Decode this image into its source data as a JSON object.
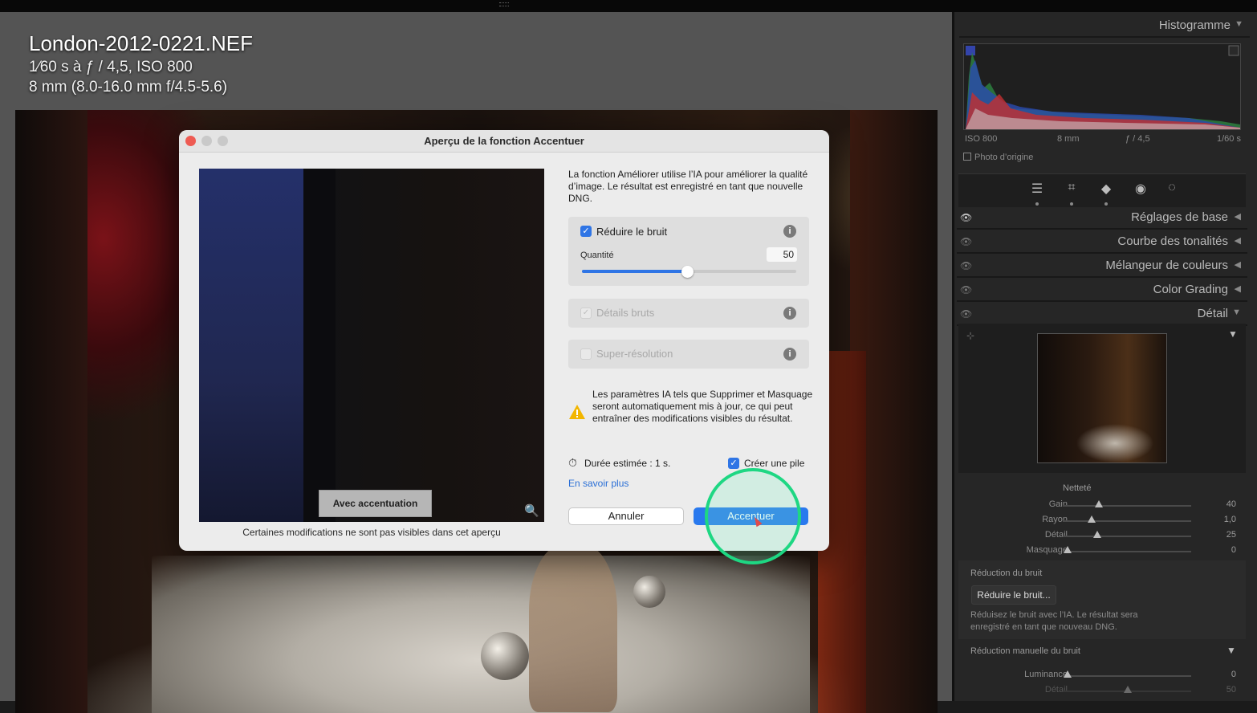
{
  "photo": {
    "filename": "London-2012-0221.NEF",
    "exposure_fraction": "1⁄60",
    "exposure_rest": " s à ƒ / 4,5, ISO 800",
    "lens": "8 mm (8.0-16.0 mm f/4.5-5.6)"
  },
  "histogram": {
    "title": "Histogramme",
    "iso": "ISO 800",
    "focal": "8 mm",
    "aperture": "ƒ / 4,5",
    "shutter": "1/60 s",
    "original_photo_label": "Photo d’origine"
  },
  "tools": [
    "sliders-icon",
    "crop-icon",
    "eraser-icon",
    "redeye-icon",
    "mask-icon"
  ],
  "panels": [
    {
      "label": "Réglages de base"
    },
    {
      "label": "Courbe des tonalités"
    },
    {
      "label": "Mélangeur de couleurs"
    },
    {
      "label": "Color Grading"
    },
    {
      "label": "Détail"
    }
  ],
  "detail": {
    "sharpness_title": "Netteté",
    "sliders": [
      {
        "name": "Gain",
        "value": "40"
      },
      {
        "name": "Rayon",
        "value": "1,0"
      },
      {
        "name": "Détail",
        "value": "25"
      },
      {
        "name": "Masquage",
        "value": "0"
      }
    ],
    "noise_reduction_title": "Réduction du bruit",
    "noise_button": "Réduire le bruit...",
    "noise_desc": "Réduisez le bruit avec l’IA. Le résultat sera enregistré en tant que nouveau DNG.",
    "manual_title": "Réduction manuelle du bruit",
    "manual_sliders": [
      {
        "name": "Luminance",
        "value": "0"
      },
      {
        "name": "Détail",
        "value": "50"
      }
    ]
  },
  "dialog": {
    "title": "Aperçu de la fonction Accentuer",
    "intro": "La fonction Améliorer utilise l’IA pour améliorer la qualité d’image. Le résultat est enregistré en tant que nouvelle DNG.",
    "option_denoise": "Réduire le bruit",
    "amount_label": "Quantité",
    "amount_value": "50",
    "option_raw_details": "Détails bruts",
    "option_super_res": "Super-résolution",
    "warning": "Les paramètres IA tels que Supprimer et Masquage seront automatiquement mis à jour, ce qui peut entraîner des modifications visibles du résultat.",
    "duration": "Durée estimée : 1 s.",
    "create_stack": "Créer une pile",
    "learn_more": "En savoir plus",
    "cancel": "Annuler",
    "apply": "Accentuer",
    "preview_toggle": "Avec accentuation",
    "preview_note": "Certaines modifications ne sont pas visibles dans cet aperçu"
  }
}
